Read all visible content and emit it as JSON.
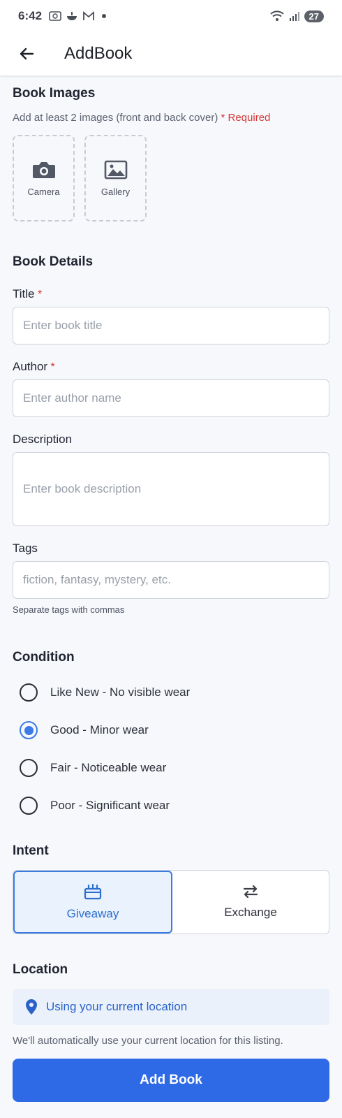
{
  "status_bar": {
    "time": "6:42",
    "battery": "27"
  },
  "app_bar": {
    "title": "AddBook"
  },
  "images": {
    "title": "Book Images",
    "hint": "Add at least 2 images (front and back cover)",
    "required": "* Required",
    "camera_label": "Camera",
    "gallery_label": "Gallery"
  },
  "details": {
    "title": "Book Details",
    "title_label": "Title",
    "title_placeholder": "Enter book title",
    "author_label": "Author",
    "author_placeholder": "Enter author name",
    "description_label": "Description",
    "description_placeholder": "Enter book description",
    "tags_label": "Tags",
    "tags_placeholder": "fiction, fantasy, mystery, etc.",
    "tags_hint": "Separate tags with commas",
    "required_mark": "*"
  },
  "condition": {
    "title": "Condition",
    "options": [
      {
        "label": "Like New - No visible wear",
        "selected": false
      },
      {
        "label": "Good - Minor wear",
        "selected": true
      },
      {
        "label": "Fair - Noticeable wear",
        "selected": false
      },
      {
        "label": "Poor - Significant wear",
        "selected": false
      }
    ]
  },
  "intent": {
    "title": "Intent",
    "giveaway": "Giveaway",
    "exchange": "Exchange",
    "selected": "Giveaway"
  },
  "location": {
    "title": "Location",
    "current": "Using your current location",
    "hint": "We'll automatically use your current location for this listing."
  },
  "submit_label": "Add Book",
  "colors": {
    "accent": "#2f6ae6",
    "required": "#d33838"
  }
}
